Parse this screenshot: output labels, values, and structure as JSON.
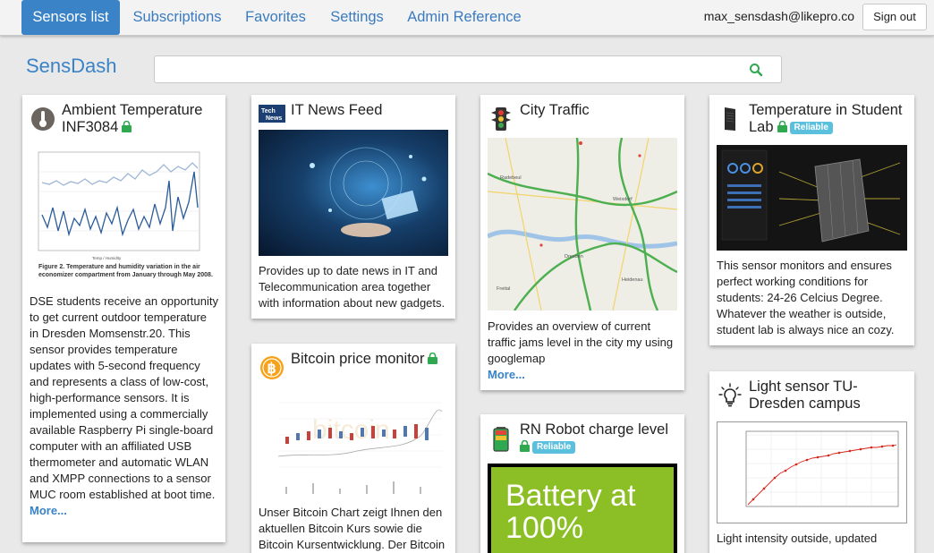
{
  "nav": {
    "tabs": [
      {
        "label": "Sensors list"
      },
      {
        "label": "Subscriptions"
      },
      {
        "label": "Favorites"
      },
      {
        "label": "Settings"
      },
      {
        "label": "Admin Reference"
      }
    ],
    "user_email": "max_sensdash@likepro.co",
    "signout_label": "Sign out"
  },
  "brand": "SensDash",
  "search": {
    "placeholder": ""
  },
  "cards": [
    {
      "title": "Ambient Temperature INF3084",
      "icon": "thermometer-icon",
      "locked": true,
      "badge": "",
      "image_caption": "Figure 2. Temperature and humidity variation in the air economizer compartment from January through May 2008.",
      "description": "DSE students receive an opportunity to get current outdoor temperature in Dresden Momsenstr.20. This sensor provides temperature updates with 5-second frequency and represents a class of low-cost, high-performance sensors. It is implemented using a commercially available Raspberry Pi single-board computer with an affiliated USB thermometer and automatic WLAN and XMPP connections to a sensor MUC room established at boot time.",
      "more": "More..."
    },
    {
      "title": "IT News Feed",
      "icon": "tech-news-icon",
      "locked": false,
      "badge": "",
      "description": "Provides up to date news in IT and Telecommunication area together with information about new gadgets.",
      "more": ""
    },
    {
      "title": "Bitcoin price monitor",
      "icon": "bitcoin-icon",
      "locked": true,
      "badge": "",
      "description": "Unser Bitcoin Chart zeigt Ihnen den aktuellen Bitcoin Kurs sowie die Bitcoin Kursentwicklung. Der Bitcoin",
      "more": ""
    },
    {
      "title": "City Traffic",
      "icon": "traffic-light-icon",
      "locked": false,
      "badge": "",
      "description": "Provides an overview of current traffic jams level in the city my using googlemap",
      "more": "More..."
    },
    {
      "title": "RN Robot charge level",
      "icon": "battery-icon",
      "locked": true,
      "badge": "Reliable",
      "image_text": "Battery at 100%",
      "description": "",
      "more": ""
    },
    {
      "title": "Temperature in Student Lab",
      "icon": "server-icon",
      "locked": true,
      "badge": "Reliable",
      "description": "This sensor monitors and ensures perfect working conditions for students: 24-26 Celcius Degree. Whatever the weather is outside, student lab is always nice an cozy.",
      "more": ""
    },
    {
      "title": "Light sensor TU-Dresden campus",
      "icon": "lightbulb-icon",
      "locked": false,
      "badge": "",
      "description": "Light intensity outside, updated",
      "more": ""
    }
  ],
  "colors": {
    "accent": "#3a83c7",
    "lock": "#2fa84f",
    "badge": "#5bc0de",
    "battery_bg": "#8cbf26"
  }
}
